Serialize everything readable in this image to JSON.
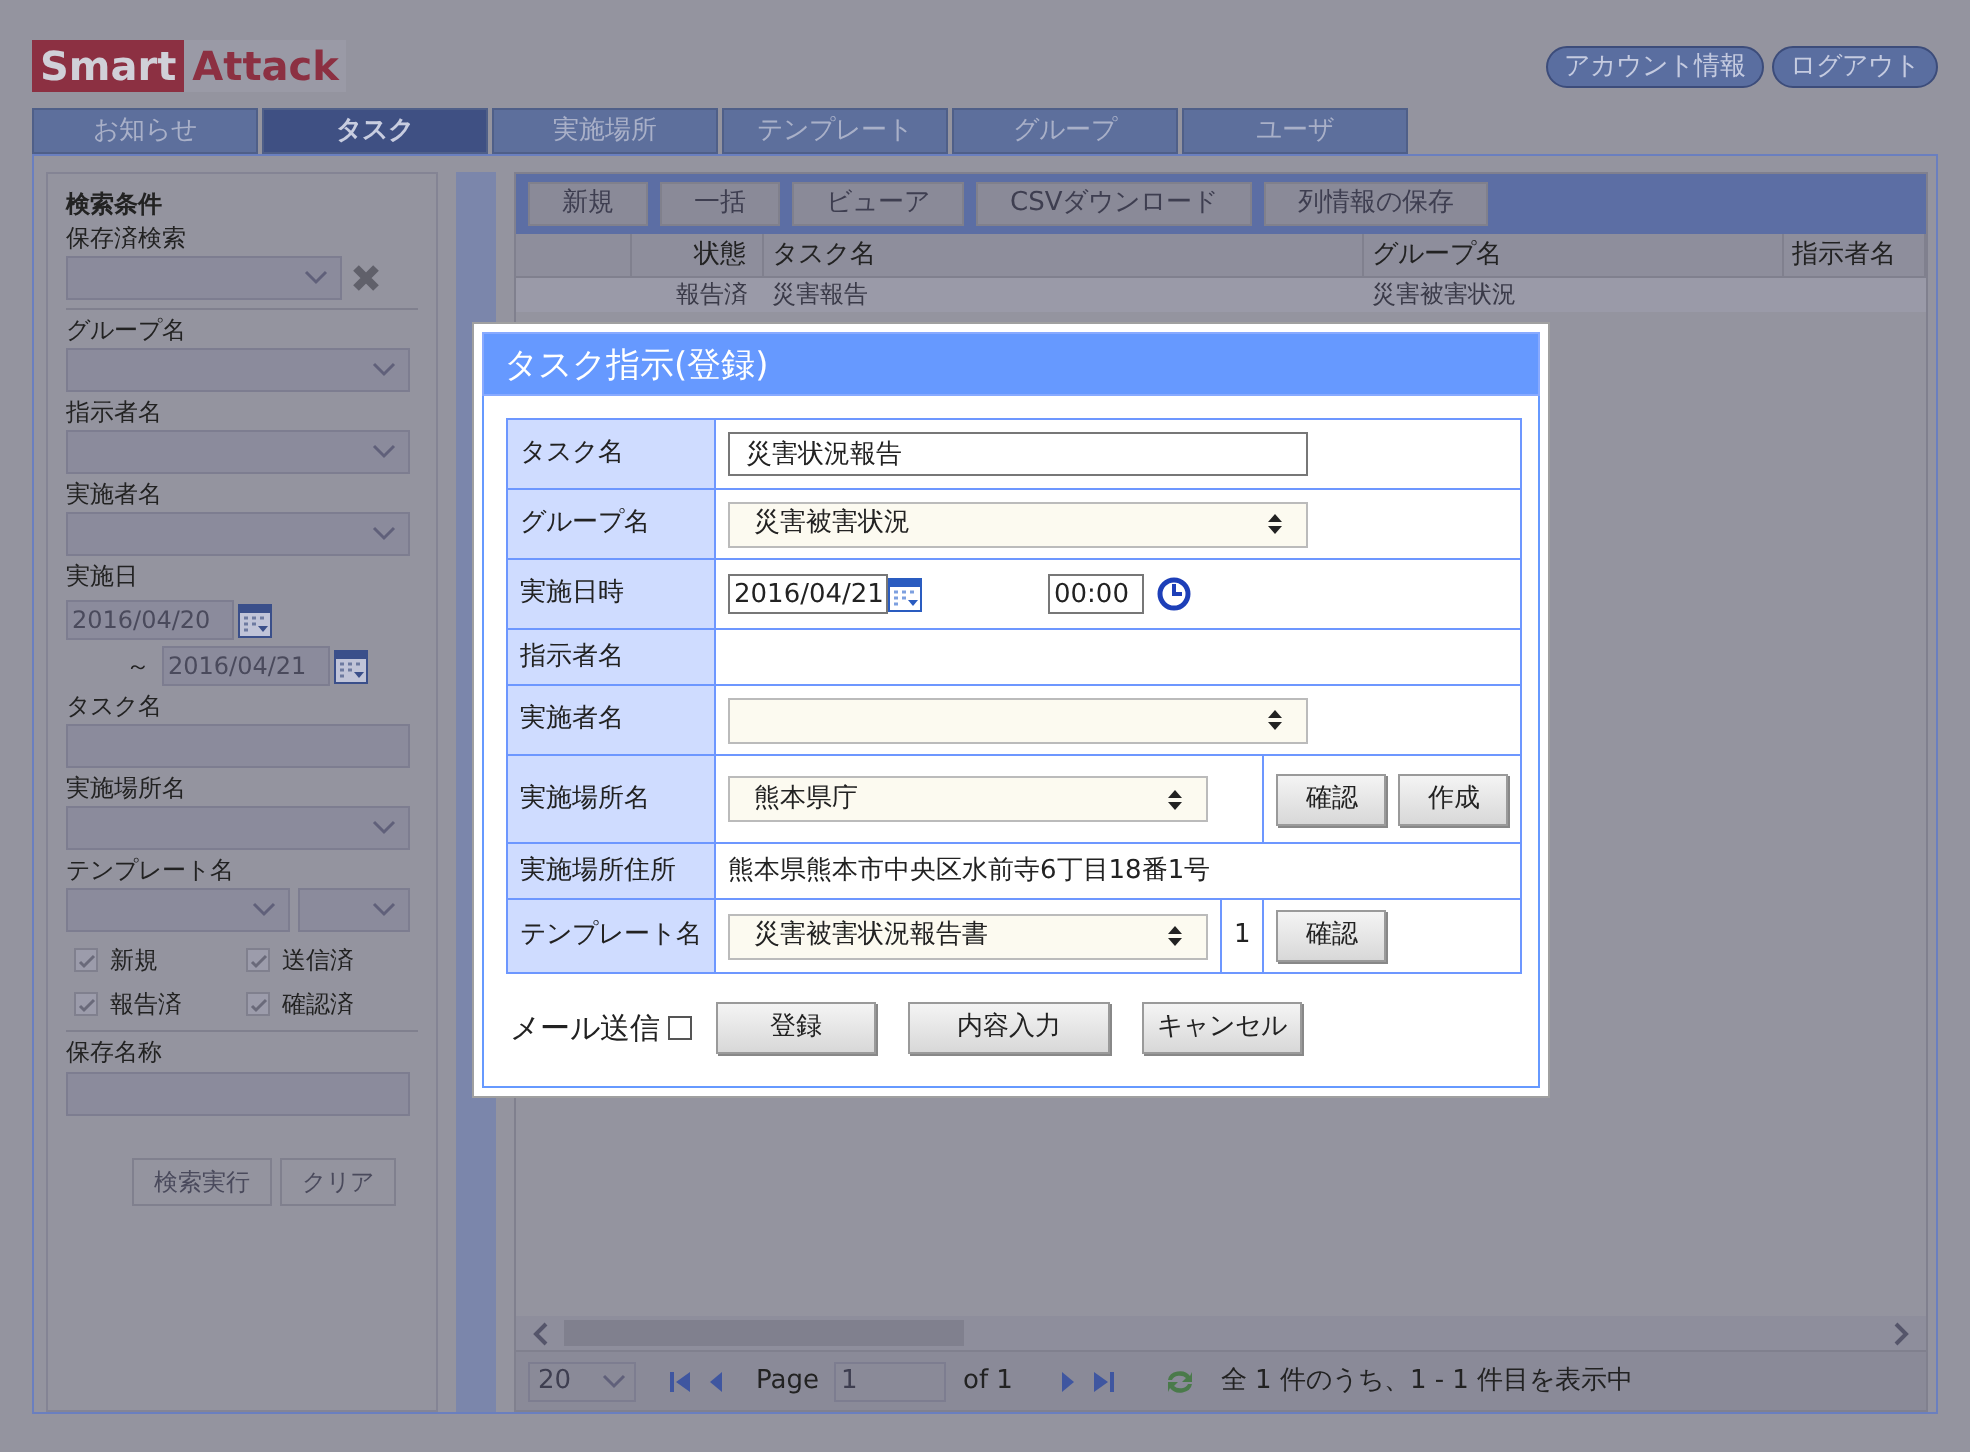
{
  "logo": {
    "first": "Smart",
    "second": "Attack"
  },
  "header_links": [
    "アカウント情報",
    "ログアウト"
  ],
  "tabs": [
    {
      "label": "お知らせ",
      "selected": false
    },
    {
      "label": "タスク",
      "selected": true
    },
    {
      "label": "実施場所",
      "selected": false
    },
    {
      "label": "テンプレート",
      "selected": false
    },
    {
      "label": "グループ",
      "selected": false
    },
    {
      "label": "ユーザ",
      "selected": false
    }
  ],
  "sidebar": {
    "title": "検索条件",
    "saved_search": "保存済検索",
    "fields": [
      {
        "kind": "select",
        "label": "グループ名"
      },
      {
        "kind": "select",
        "label": "指示者名"
      },
      {
        "kind": "select",
        "label": "実施者名"
      },
      {
        "kind": "date_range",
        "label": "実施日",
        "value": "2016/04/20",
        "separator": "～",
        "value_to": "2016/04/21"
      },
      {
        "kind": "text",
        "label": "タスク名"
      },
      {
        "kind": "select",
        "label": "実施場所名"
      },
      {
        "kind": "double_select",
        "label": "テンプレート名"
      }
    ],
    "checkboxes": [
      {
        "label": "新規",
        "checked": true
      },
      {
        "label": "送信済",
        "checked": true
      },
      {
        "label": "報告済",
        "checked": true
      },
      {
        "label": "確認済",
        "checked": true
      }
    ],
    "save_name": "保存名称",
    "buttons": [
      "検索実行",
      "クリア"
    ]
  },
  "toolbar": [
    "新規",
    "一括",
    "ビューア",
    "CSVダウンロード",
    "列情報の保存"
  ],
  "table": {
    "columns": [
      "状態",
      "タスク名",
      "グループ名",
      "指示者名"
    ],
    "rows": [
      [
        "報告済",
        "災害報告",
        "災害被害状況"
      ]
    ]
  },
  "pager": {
    "page_size": "20",
    "page_label": "Page",
    "page_value": "1",
    "of": "of 1",
    "summary": "全 1 件のうち、1 - 1 件目を表示中"
  },
  "modal": {
    "title": "タスク指示(登録)",
    "rows": [
      {
        "kind": "text",
        "label": "タスク名",
        "value": "災害状況報告"
      },
      {
        "kind": "select",
        "label": "グループ名",
        "value": "災害被害状況"
      },
      {
        "kind": "datetime",
        "label": "実施日時",
        "value": "2016/04/21",
        "time": "00:00"
      },
      {
        "kind": "plain",
        "label": "指示者名"
      },
      {
        "kind": "select",
        "label": "実施者名"
      },
      {
        "kind": "select_buttons",
        "label": "実施場所名",
        "value": "熊本県庁",
        "buttons": [
          "確認",
          "作成"
        ]
      },
      {
        "kind": "plain",
        "label": "実施場所住所",
        "value": "熊本県熊本市中央区水前寺6丁目18番1号"
      },
      {
        "kind": "template",
        "label": "テンプレート名",
        "value": "災害被害状況報告書",
        "count": "1",
        "buttons": [
          "確認"
        ]
      }
    ],
    "mail_label": "メール送信",
    "mail_checked": false,
    "buttons": [
      "登録",
      "内容入力",
      "キャンセル"
    ]
  }
}
